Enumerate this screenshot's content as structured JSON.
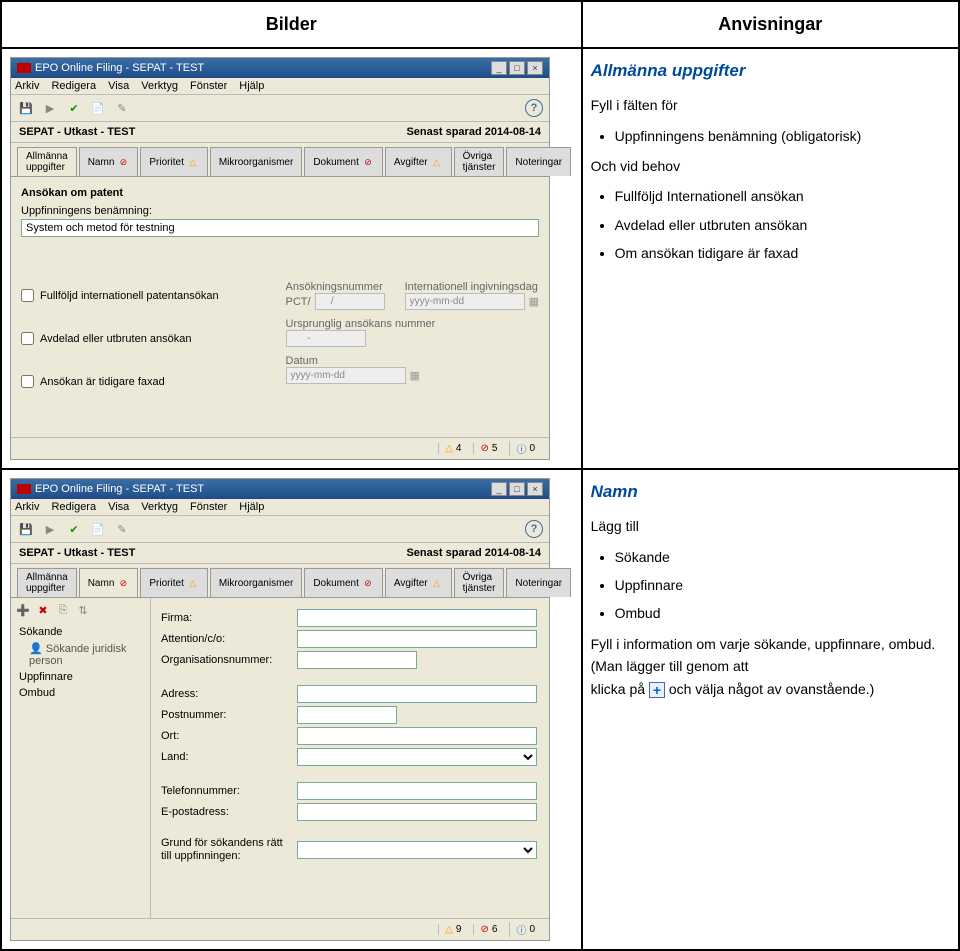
{
  "headers": {
    "left": "Bilder",
    "right": "Anvisningar"
  },
  "window1": {
    "title": "EPO Online Filing - SEPAT - TEST",
    "menu": [
      "Arkiv",
      "Redigera",
      "Visa",
      "Verktyg",
      "Fönster",
      "Hjälp"
    ],
    "status_left": "SEPAT - Utkast - TEST",
    "status_right": "Senast sparad 2014-08-14",
    "tabs": [
      {
        "label": "Allmänna uppgifter",
        "badge": ""
      },
      {
        "label": "Namn",
        "badge": "⊘",
        "cls": "badge-red"
      },
      {
        "label": "Prioritet",
        "badge": "△",
        "cls": "badge-warn"
      },
      {
        "label": "Mikroorganismer",
        "badge": ""
      },
      {
        "label": "Dokument",
        "badge": "⊘",
        "cls": "badge-red"
      },
      {
        "label": "Avgifter",
        "badge": "△",
        "cls": "badge-warn"
      },
      {
        "label": "Övriga tjänster",
        "badge": ""
      },
      {
        "label": "Noteringar",
        "badge": ""
      }
    ],
    "section_title": "Ansökan om patent",
    "benamn_label": "Uppfinningens benämning:",
    "benamn_value": "System och metod för testning",
    "checks": [
      "Fullföljd internationell patentansökan",
      "Avdelad eller utbruten ansökan",
      "Ansökan är tidigare faxad"
    ],
    "rc_labels": {
      "ansokningsnummer": "Ansökningsnummer",
      "ingivningsdag": "Internationell ingivningsdag",
      "pct": "PCT/",
      "date_placeholder": "yyyy-mm-dd",
      "ursprunglig": "Ursprunglig ansökans nummer",
      "datum": "Datum"
    },
    "statusbar": {
      "warn": "4",
      "err": "5",
      "info": "0"
    }
  },
  "window2": {
    "title": "EPO Online Filing - SEPAT - TEST",
    "menu": [
      "Arkiv",
      "Redigera",
      "Visa",
      "Verktyg",
      "Fönster",
      "Hjälp"
    ],
    "status_left": "SEPAT - Utkast - TEST",
    "status_right": "Senast sparad 2014-08-14",
    "tabs": [
      {
        "label": "Allmänna uppgifter",
        "badge": ""
      },
      {
        "label": "Namn",
        "badge": "⊘",
        "cls": "badge-red"
      },
      {
        "label": "Prioritet",
        "badge": "△",
        "cls": "badge-warn"
      },
      {
        "label": "Mikroorganismer",
        "badge": ""
      },
      {
        "label": "Dokument",
        "badge": "⊘",
        "cls": "badge-red"
      },
      {
        "label": "Avgifter",
        "badge": "△",
        "cls": "badge-warn"
      },
      {
        "label": "Övriga tjänster",
        "badge": ""
      },
      {
        "label": "Noteringar",
        "badge": ""
      }
    ],
    "tree": {
      "sokande": "Sökande",
      "sokande_sub": "Sökande juridisk person",
      "uppfinnare": "Uppfinnare",
      "ombud": "Ombud"
    },
    "fields": {
      "firma": "Firma:",
      "attention": "Attention/c/o:",
      "orgnr": "Organisationsnummer:",
      "adress": "Adress:",
      "postnr": "Postnummer:",
      "ort": "Ort:",
      "land": "Land:",
      "telefon": "Telefonnummer:",
      "epost": "E-postadress:",
      "grund": "Grund för sökandens rätt till uppfinningen:"
    },
    "statusbar": {
      "warn": "9",
      "err": "6",
      "info": "0"
    }
  },
  "instr1": {
    "title": "Allmänna uppgifter",
    "lead": "Fyll i fälten för",
    "b1": "Uppfinningens benämning (obligatorisk)",
    "mid": "Och vid behov",
    "b2": "Fullföljd Internationell ansökan",
    "b3": "Avdelad eller utbruten ansökan",
    "b4": "Om ansökan tidigare är faxad"
  },
  "instr2": {
    "title": "Namn",
    "lead": "Lägg till",
    "b1": "Sökande",
    "b2": "Uppfinnare",
    "b3": "Ombud",
    "p1": "Fyll i information om varje sökande, uppfinnare, ombud.",
    "p2a": "(Man lägger till genom att",
    "p2b": "klicka på ",
    "p2c": " och välja något av ovanstående.)"
  }
}
